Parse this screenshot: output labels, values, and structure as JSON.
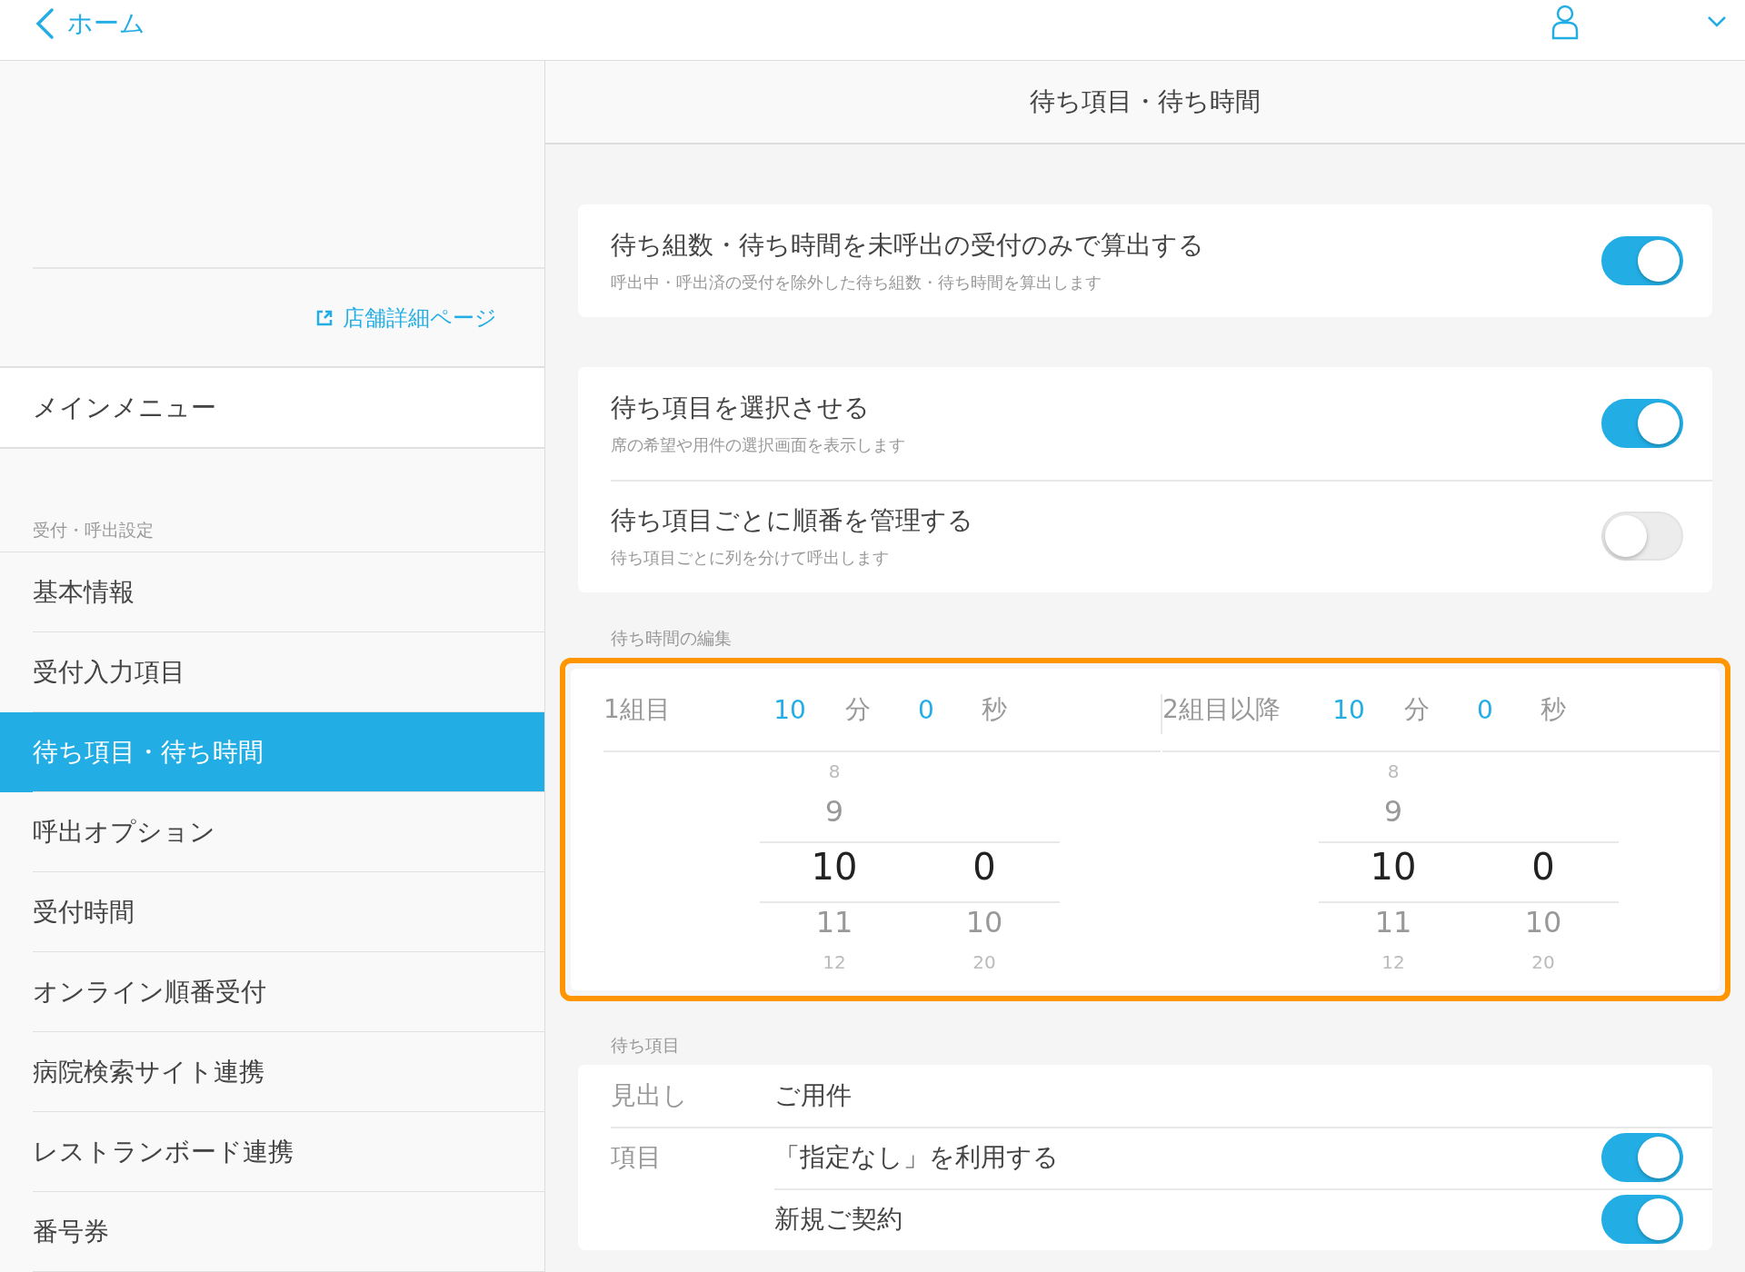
{
  "top_bar": {
    "back_label": "ホーム"
  },
  "sidebar": {
    "store_link": "店舗詳細ページ",
    "main_menu": "メインメニュー",
    "section_label": "受付・呼出設定",
    "items": [
      {
        "label": "基本情報",
        "selected": false
      },
      {
        "label": "受付入力項目",
        "selected": false
      },
      {
        "label": "待ち項目・待ち時間",
        "selected": true
      },
      {
        "label": "呼出オプション",
        "selected": false
      },
      {
        "label": "受付時間",
        "selected": false
      },
      {
        "label": "オンライン順番受付",
        "selected": false
      },
      {
        "label": "病院検索サイト連携",
        "selected": false
      },
      {
        "label": "レストランボード連携",
        "selected": false
      },
      {
        "label": "番号券",
        "selected": false
      }
    ]
  },
  "page_title": "待ち項目・待ち時間",
  "settings_groups": [
    [
      {
        "title": "待ち組数・待ち時間を未呼出の受付のみで算出する",
        "description": "呼出中・呼出済の受付を除外した待ち組数・待ち時間を算出します",
        "on": true
      }
    ],
    [
      {
        "title": "待ち項目を選択させる",
        "description": "席の希望や用件の選択画面を表示します",
        "on": true
      },
      {
        "title": "待ち項目ごとに順番を管理する",
        "description": "待ち項目ごとに列を分けて呼出します",
        "on": false
      }
    ]
  ],
  "wait_time_edit": {
    "label": "待ち時間の編集",
    "highlighted": true,
    "pickers": [
      {
        "label": "1組目",
        "minutes": "10",
        "minute_unit": "分",
        "seconds": "0",
        "second_unit": "秒",
        "minute_wheel": [
          {
            "value": "8",
            "selected": false
          },
          {
            "value": "9",
            "selected": false
          },
          {
            "value": "10",
            "selected": true
          },
          {
            "value": "11",
            "selected": false
          },
          {
            "value": "12",
            "selected": false
          }
        ],
        "second_wheel": [
          {
            "value": "0",
            "selected": true
          },
          {
            "value": "10",
            "selected": false
          },
          {
            "value": "20",
            "selected": false
          }
        ]
      },
      {
        "label": "2組目以降",
        "minutes": "10",
        "minute_unit": "分",
        "seconds": "0",
        "second_unit": "秒",
        "minute_wheel": [
          {
            "value": "8",
            "selected": false
          },
          {
            "value": "9",
            "selected": false
          },
          {
            "value": "10",
            "selected": true
          },
          {
            "value": "11",
            "selected": false
          },
          {
            "value": "12",
            "selected": false
          }
        ],
        "second_wheel": [
          {
            "value": "0",
            "selected": true
          },
          {
            "value": "10",
            "selected": false
          },
          {
            "value": "20",
            "selected": false
          }
        ]
      }
    ]
  },
  "wait_items": {
    "label": "待ち項目",
    "heading_label": "見出し",
    "heading_value": "ご用件",
    "items_label": "項目",
    "items": [
      {
        "label": "「指定なし」を利用する",
        "on": true
      },
      {
        "label": "新規ご契約",
        "on": true
      }
    ]
  }
}
